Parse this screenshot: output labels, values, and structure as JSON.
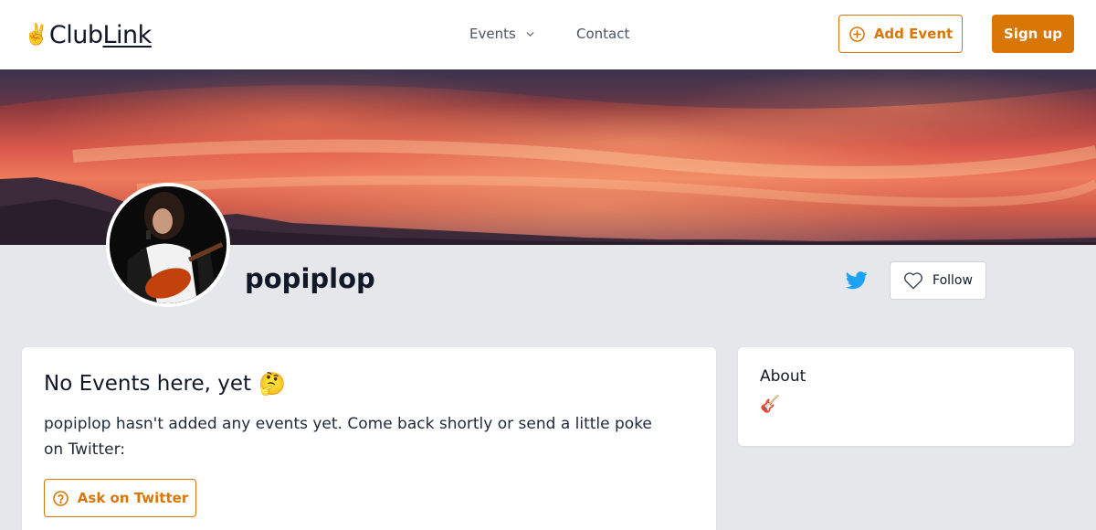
{
  "header": {
    "logo": {
      "emoji": "✌️",
      "text_a": "Club",
      "text_b": "Link"
    },
    "nav": {
      "events_label": "Events",
      "contact_label": "Contact"
    },
    "add_event_label": "Add Event",
    "signup_label": "Sign up"
  },
  "profile": {
    "name": "popiplop",
    "follow_label": "Follow"
  },
  "events_card": {
    "title": "No Events here, yet",
    "title_emoji": "🤔",
    "message": "popiplop hasn't added any events yet. Come back shortly or send a little poke on Twitter:",
    "ask_button_label": "Ask on Twitter"
  },
  "about_card": {
    "title": "About",
    "content": "🎸"
  },
  "colors": {
    "accent": "#d97706",
    "twitter": "#1da1f2",
    "background": "#e5e7eb"
  },
  "icons": {
    "nav_events": "chevron-down-icon",
    "add_event": "plus-circle-icon",
    "twitter": "twitter-icon",
    "follow": "heart-icon",
    "ask": "question-circle-icon"
  }
}
